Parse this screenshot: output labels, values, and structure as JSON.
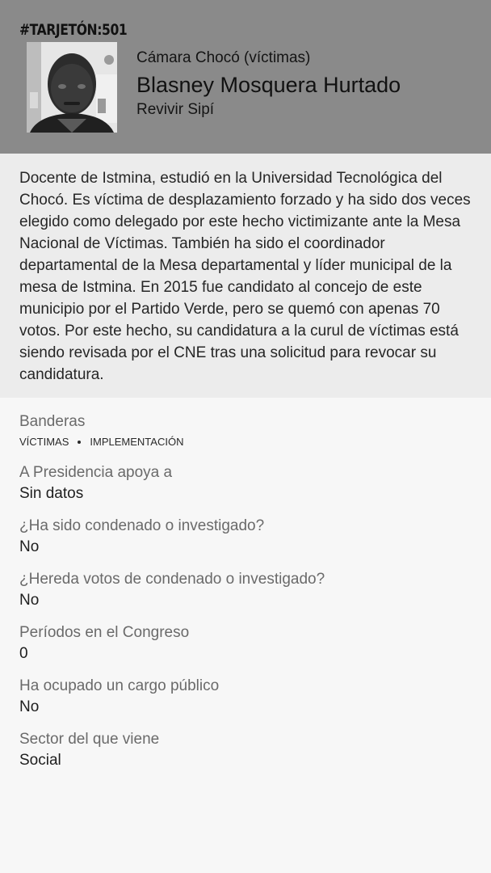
{
  "header": {
    "tarjeton": "#TARJETÓN:501",
    "chamber": "Cámara Chocó (víctimas)",
    "name": "Blasney Mosquera Hurtado",
    "party": "Revivir Sipí"
  },
  "bio": {
    "text": "Docente de Istmina, estudió en la Universidad Tecnológica del Chocó. Es víctima de desplazamiento forzado y ha sido dos veces elegido como delegado por este hecho victimizante ante la Mesa Nacional de Víctimas. También ha sido el coordinador departamental de la Mesa departamental y líder municipal de la mesa de Istmina. En 2015 fue candidato al concejo de este municipio por el Partido Verde, pero se quemó con apenas 70 votos. Por este hecho, su candidatura a la curul de víctimas está siendo revisada por el CNE tras una solicitud para revocar su candidatura."
  },
  "details": {
    "banderas": {
      "label": "Banderas",
      "items": [
        "VÍCTIMAS",
        "IMPLEMENTACIÓN"
      ]
    },
    "presidencia": {
      "label": "A Presidencia apoya a",
      "value": "Sin datos"
    },
    "condenado": {
      "label": "¿Ha sido condenado o investigado?",
      "value": "No"
    },
    "hereda": {
      "label": "¿Hereda votos de condenado o investigado?",
      "value": "No"
    },
    "periodos": {
      "label": "Períodos en el Congreso",
      "value": "0"
    },
    "cargo": {
      "label": "Ha ocupado un cargo público",
      "value": "No"
    },
    "sector": {
      "label": "Sector del que viene",
      "value": "Social"
    }
  },
  "colors": {
    "header_bg": "#8a8a8a",
    "bio_bg": "#ececec",
    "page_bg": "#f7f7f7",
    "label_text": "#6a6a6a"
  }
}
